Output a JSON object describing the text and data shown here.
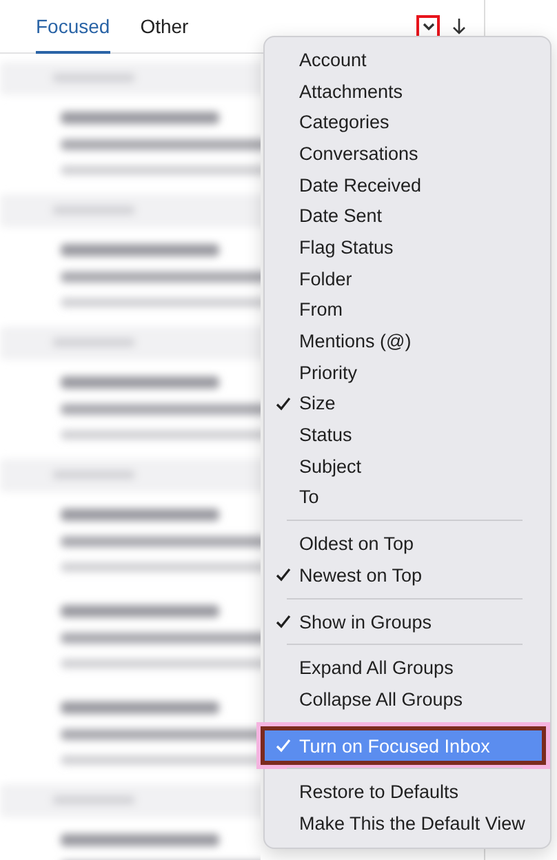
{
  "tabs": [
    {
      "label": "Focused",
      "selected": true
    },
    {
      "label": "Other",
      "selected": false
    }
  ],
  "toolbar": {
    "dropdown_button": {
      "annotated": true
    }
  },
  "menu": {
    "sections": [
      {
        "items": [
          {
            "label": "Account",
            "checked": false,
            "selected": false,
            "annotated": false
          },
          {
            "label": "Attachments",
            "checked": false,
            "selected": false,
            "annotated": false
          },
          {
            "label": "Categories",
            "checked": false,
            "selected": false,
            "annotated": false
          },
          {
            "label": "Conversations",
            "checked": false,
            "selected": false,
            "annotated": false
          },
          {
            "label": "Date Received",
            "checked": false,
            "selected": false,
            "annotated": false
          },
          {
            "label": "Date Sent",
            "checked": false,
            "selected": false,
            "annotated": false
          },
          {
            "label": "Flag Status",
            "checked": false,
            "selected": false,
            "annotated": false
          },
          {
            "label": "Folder",
            "checked": false,
            "selected": false,
            "annotated": false
          },
          {
            "label": "From",
            "checked": false,
            "selected": false,
            "annotated": false
          },
          {
            "label": "Mentions (@)",
            "checked": false,
            "selected": false,
            "annotated": false
          },
          {
            "label": "Priority",
            "checked": false,
            "selected": false,
            "annotated": false
          },
          {
            "label": "Size",
            "checked": true,
            "selected": false,
            "annotated": false
          },
          {
            "label": "Status",
            "checked": false,
            "selected": false,
            "annotated": false
          },
          {
            "label": "Subject",
            "checked": false,
            "selected": false,
            "annotated": false
          },
          {
            "label": "To",
            "checked": false,
            "selected": false,
            "annotated": false
          }
        ]
      },
      {
        "items": [
          {
            "label": "Oldest on Top",
            "checked": false,
            "selected": false,
            "annotated": false
          },
          {
            "label": "Newest on Top",
            "checked": true,
            "selected": false,
            "annotated": false
          }
        ]
      },
      {
        "items": [
          {
            "label": "Show in Groups",
            "checked": true,
            "selected": false,
            "annotated": false
          }
        ]
      },
      {
        "items": [
          {
            "label": "Expand All Groups",
            "checked": false,
            "selected": false,
            "annotated": false
          },
          {
            "label": "Collapse All Groups",
            "checked": false,
            "selected": false,
            "annotated": false
          }
        ]
      },
      {
        "items": [
          {
            "label": "Turn on Focused Inbox",
            "checked": true,
            "selected": true,
            "annotated": true
          }
        ]
      },
      {
        "items": [
          {
            "label": "Restore to Defaults",
            "checked": false,
            "selected": false,
            "annotated": false
          },
          {
            "label": "Make This the Default View",
            "checked": false,
            "selected": false,
            "annotated": false
          }
        ]
      }
    ]
  }
}
